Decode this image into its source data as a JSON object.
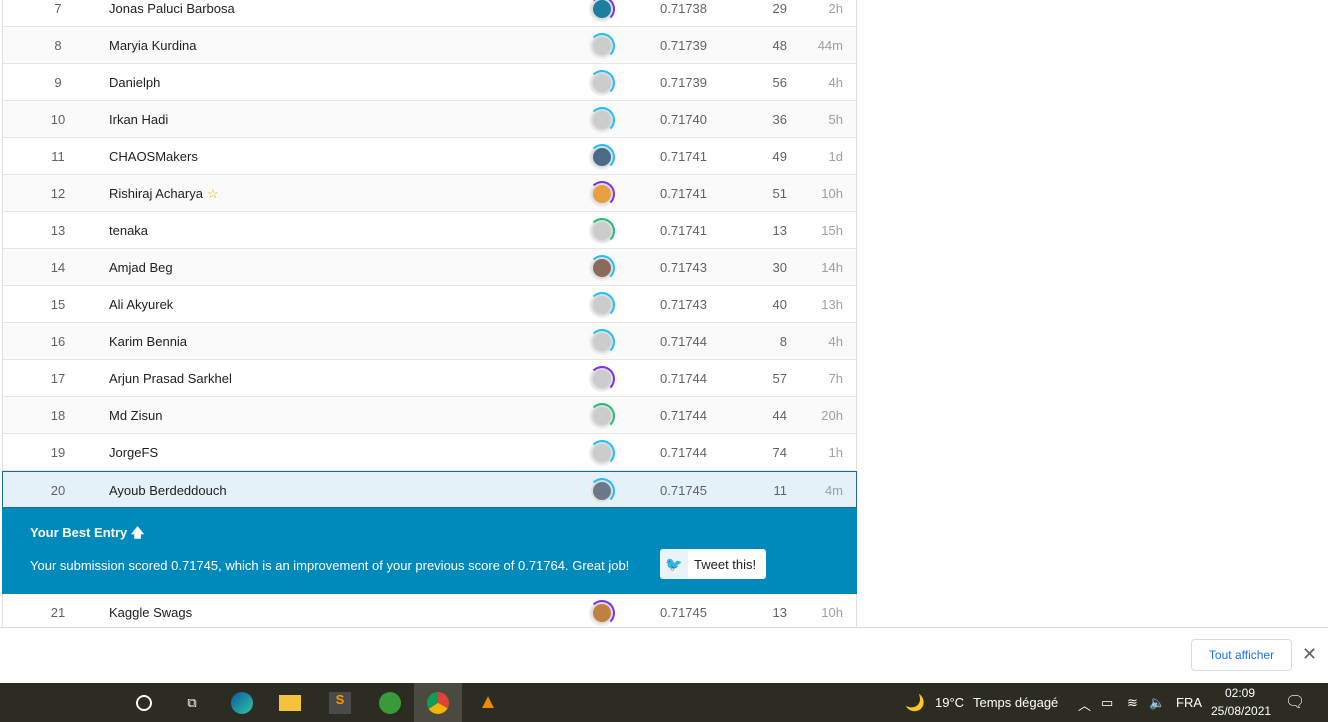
{
  "leaderboard": [
    {
      "rank": "7",
      "name": "Jonas Paluci Barbosa",
      "score": "0.71738",
      "entries": "29",
      "last": "2h",
      "ring": "#7b2ff7",
      "avatar": "#1b7fa0"
    },
    {
      "rank": "8",
      "name": "Maryia Kurdina",
      "score": "0.71739",
      "entries": "48",
      "last": "44m",
      "ring": "#20beff",
      "avatar": "#ccc"
    },
    {
      "rank": "9",
      "name": "Danielph",
      "score": "0.71739",
      "entries": "56",
      "last": "4h",
      "ring": "#20beff",
      "avatar": "#ccc"
    },
    {
      "rank": "10",
      "name": "Irkan Hadi",
      "score": "0.71740",
      "entries": "36",
      "last": "5h",
      "ring": "#20beff",
      "avatar": "#ccc"
    },
    {
      "rank": "11",
      "name": "CHAOSMakers",
      "score": "0.71741",
      "entries": "49",
      "last": "1d",
      "ring": "#20beff",
      "avatar": "#4a6a88"
    },
    {
      "rank": "12",
      "name": "Rishiraj Acharya",
      "star": true,
      "score": "0.71741",
      "entries": "51",
      "last": "10h",
      "ring": "#7b2ff7",
      "avatar": "#e8a040"
    },
    {
      "rank": "13",
      "name": "tenaka",
      "score": "0.71741",
      "entries": "13",
      "last": "15h",
      "ring": "#20c070",
      "avatar": "#ccc"
    },
    {
      "rank": "14",
      "name": "Amjad Beg",
      "score": "0.71743",
      "entries": "30",
      "last": "14h",
      "ring": "#20beff",
      "avatar": "#8a6a5a"
    },
    {
      "rank": "15",
      "name": "Ali Akyurek",
      "score": "0.71743",
      "entries": "40",
      "last": "13h",
      "ring": "#20beff",
      "avatar": "#ccc"
    },
    {
      "rank": "16",
      "name": "Karim Bennia",
      "score": "0.71744",
      "entries": "8",
      "last": "4h",
      "ring": "#20beff",
      "avatar": "#ccc"
    },
    {
      "rank": "17",
      "name": "Arjun Prasad Sarkhel",
      "score": "0.71744",
      "entries": "57",
      "last": "7h",
      "ring": "#7b2ff7",
      "avatar": "#ccc"
    },
    {
      "rank": "18",
      "name": "Md Zisun",
      "score": "0.71744",
      "entries": "44",
      "last": "20h",
      "ring": "#20c070",
      "avatar": "#ccc"
    },
    {
      "rank": "19",
      "name": "JorgeFS",
      "score": "0.71744",
      "entries": "74",
      "last": "1h",
      "ring": "#20beff",
      "avatar": "#ccc"
    },
    {
      "rank": "20",
      "name": "Ayoub Berdeddouch",
      "score": "0.71745",
      "entries": "11",
      "last": "4m",
      "ring": "#20beff",
      "avatar": "#6a7a8a",
      "me": true
    }
  ],
  "after": {
    "rank": "21",
    "name": "Kaggle Swags",
    "score": "0.71745",
    "entries": "13",
    "last": "10h",
    "ring": "#7b2ff7",
    "avatar": "#c08040"
  },
  "banner": {
    "title": "Your Best Entry 🡅",
    "message": "Your submission scored 0.71745, which is an improvement of your previous score of 0.71764. Great job!",
    "tweet_label": "Tweet this!"
  },
  "download_bar": {
    "show_all": "Tout afficher",
    "close": "✕"
  },
  "taskbar": {
    "weather_temp": "19°C",
    "weather_text": "Temps dégagé",
    "language": "FRA",
    "time": "02:09",
    "date": "25/08/2021"
  }
}
